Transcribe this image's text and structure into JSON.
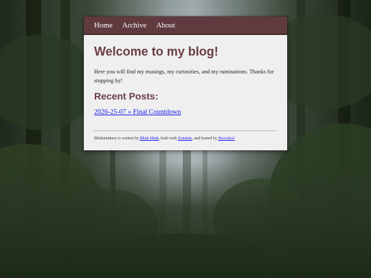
{
  "nav": {
    "home": "Home",
    "archive": "Archive",
    "about": "About"
  },
  "main": {
    "title": "Welcome to my blog!",
    "intro": "Here you will find my musings, my curiosities, and my ruminations. Thanks for stopping by!",
    "recent_heading": "Recent Posts:",
    "posts": [
      {
        "label": "2026-25-07 » Final Countdown"
      }
    ]
  },
  "footer": {
    "text_1": "Blinkminkery is written by ",
    "author": "Blink Mink",
    "text_2": ", built with ",
    "builder": "Zonelets",
    "text_3": ", and hosted by ",
    "host": "Neocities!"
  },
  "colors": {
    "nav_bg": "#5f3b3f",
    "heading": "#6a3d42",
    "link": "#1a1aee",
    "card_bg": "#efefef"
  }
}
